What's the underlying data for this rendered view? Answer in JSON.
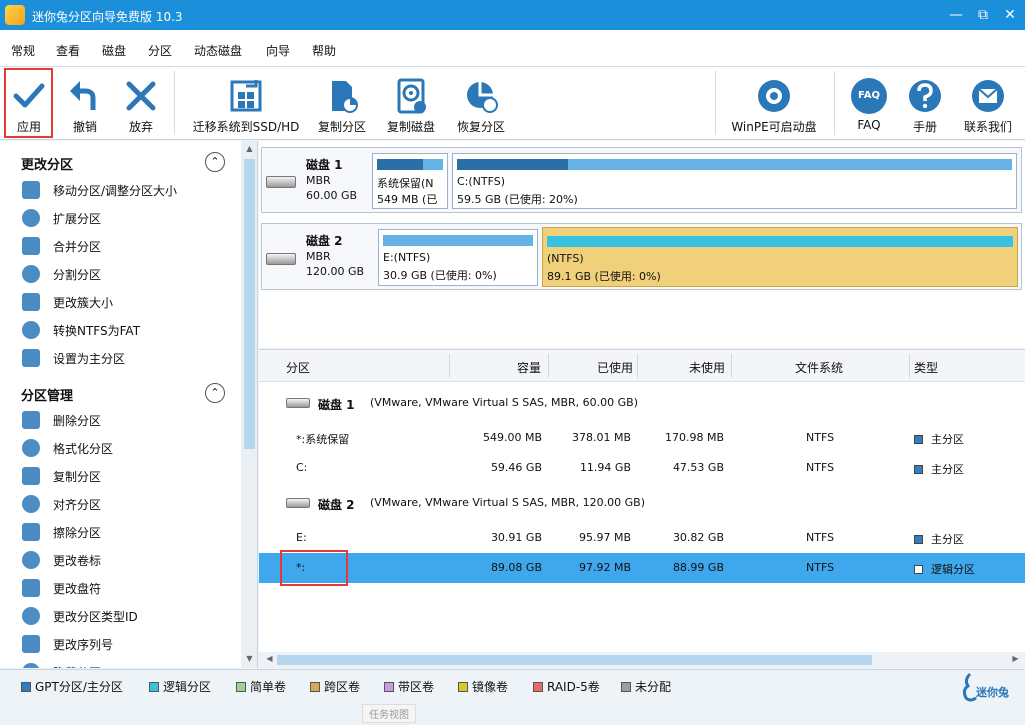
{
  "window": {
    "title": "迷你兔分区向导免费版 10.3"
  },
  "menu": [
    "常规",
    "查看",
    "磁盘",
    "分区",
    "动态磁盘",
    "向导",
    "帮助"
  ],
  "toolbar": {
    "apply": "应用",
    "undo": "撤销",
    "discard": "放弃",
    "migrate": "迁移系统到SSD/HD",
    "copy_partition": "复制分区",
    "copy_disk": "复制磁盘",
    "recover": "恢复分区",
    "winpe": "WinPE可启动盘",
    "faq": "FAQ",
    "manual": "手册",
    "contact": "联系我们",
    "faq_icon_text": "FAQ"
  },
  "left": {
    "sec1": "更改分区",
    "items1": [
      "移动分区/调整分区大小",
      "扩展分区",
      "合并分区",
      "分割分区",
      "更改簇大小",
      "转换NTFS为FAT",
      "设置为主分区"
    ],
    "sec2": "分区管理",
    "items2": [
      "删除分区",
      "格式化分区",
      "复制分区",
      "对齐分区",
      "擦除分区",
      "更改卷标",
      "更改盘符",
      "更改分区类型ID",
      "更改序列号",
      "隐藏分区"
    ]
  },
  "disks": [
    {
      "name": "磁盘 1",
      "type": "MBR",
      "size": "60.00 GB",
      "parts": [
        {
          "l1": "系统保留(N",
          "l2": "549 MB (已",
          "used": 0.69
        },
        {
          "l1": "C:(NTFS)",
          "l2": "59.5 GB (已使用: 20%)",
          "used": 0.2
        }
      ]
    },
    {
      "name": "磁盘 2",
      "type": "MBR",
      "size": "120.00 GB",
      "parts": [
        {
          "l1": "E:(NTFS)",
          "l2": "30.9 GB (已使用: 0%)",
          "used": 0.0
        },
        {
          "l1": "(NTFS)",
          "l2": "89.1 GB (已使用: 0%)",
          "used": 0.0
        }
      ]
    }
  ],
  "table": {
    "headers": [
      "分区",
      "容量",
      "已使用",
      "未使用",
      "文件系统",
      "类型"
    ],
    "disk1_label": "磁盘 1",
    "disk1_info": "(VMware, VMware Virtual S SAS, MBR, 60.00 GB)",
    "disk2_label": "磁盘 2",
    "disk2_info": "(VMware, VMware Virtual S SAS, MBR, 120.00 GB)",
    "rows": [
      {
        "name": "*:系统保留",
        "cap": "549.00 MB",
        "used": "378.01 MB",
        "free": "170.98 MB",
        "fs": "NTFS",
        "type": "主分区"
      },
      {
        "name": "C:",
        "cap": "59.46 GB",
        "used": "11.94 GB",
        "free": "47.53 GB",
        "fs": "NTFS",
        "type": "主分区"
      },
      {
        "name": "E:",
        "cap": "30.91 GB",
        "used": "95.97 MB",
        "free": "30.82 GB",
        "fs": "NTFS",
        "type": "主分区"
      },
      {
        "name": "*:",
        "cap": "89.08 GB",
        "used": "97.92 MB",
        "free": "88.99 GB",
        "fs": "NTFS",
        "type": "逻辑分区"
      }
    ]
  },
  "legend": [
    "GPT分区/主分区",
    "逻辑分区",
    "简单卷",
    "跨区卷",
    "带区卷",
    "镜像卷",
    "RAID-5卷",
    "未分配"
  ],
  "legend_colors": [
    "#2f7fc1",
    "#36c2e0",
    "#9ed19a",
    "#d9a65a",
    "#c89ae0",
    "#d6c92a",
    "#e86a6a",
    "#9e9e9e"
  ],
  "brand": "迷你兔",
  "tooltip": "任务视图",
  "colors": {
    "accent": "#1c8fdb",
    "selected": "#3fa8ec",
    "highlight_box": "#e53935",
    "logical_fill": "#f0d07a"
  }
}
